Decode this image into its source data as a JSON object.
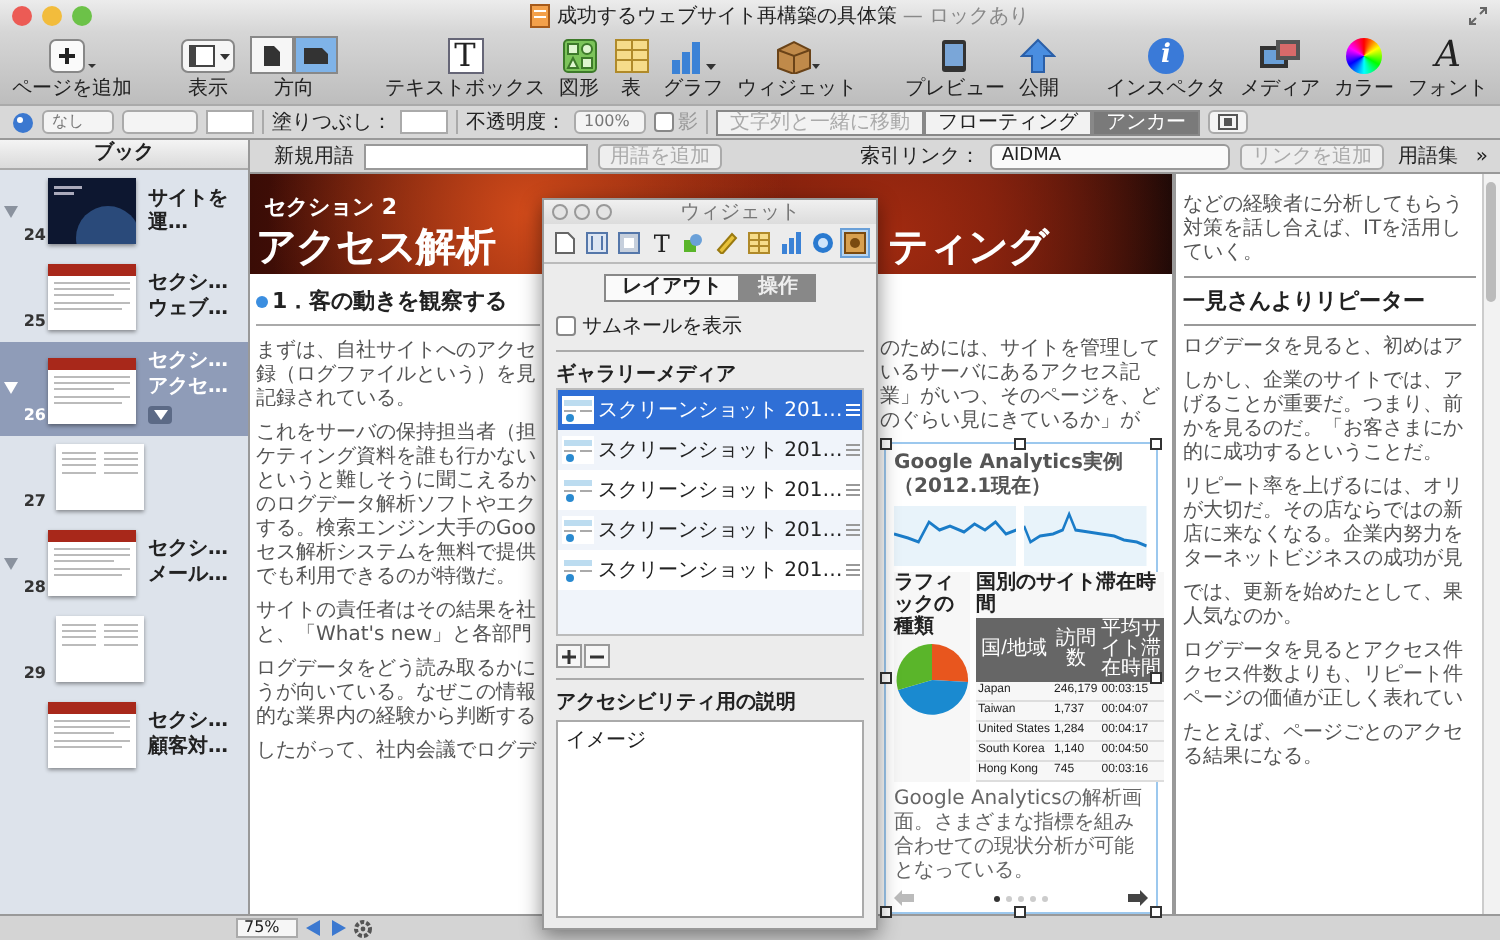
{
  "window": {
    "title": "成功するウェブサイト再構築の具体策",
    "suffix": "— ロックあり"
  },
  "toolbar": [
    {
      "kind": "add",
      "label": "ページを追加"
    },
    {
      "kind": "view",
      "label": "表示"
    },
    {
      "kind": "orientation",
      "label": "方向",
      "segments": [
        {
          "selected": false
        },
        {
          "selected": true
        }
      ]
    },
    {
      "kind": "textbox",
      "label": "テキストボックス",
      "glyph": "T"
    },
    {
      "kind": "shapes",
      "label": "図形"
    },
    {
      "kind": "table",
      "label": "表"
    },
    {
      "kind": "chart",
      "label": "グラフ"
    },
    {
      "kind": "widget",
      "label": "ウィジェット"
    },
    {
      "kind": "preview",
      "label": "プレビュー"
    },
    {
      "kind": "publish",
      "label": "公開"
    },
    {
      "kind": "inspector",
      "label": "インスペクタ",
      "glyph": "i"
    },
    {
      "kind": "media",
      "label": "メディア"
    },
    {
      "kind": "colors",
      "label": "カラー"
    },
    {
      "kind": "fonts",
      "label": "フォント",
      "glyph": "A"
    }
  ],
  "format_bar": {
    "line_style": "なし",
    "fill_label": "塗りつぶし：",
    "opacity_label": "不透明度：",
    "opacity": "100%",
    "shadow": {
      "label": "影",
      "checked": false
    },
    "wrap_modes": [
      {
        "label": "文字列と一緒に移動",
        "selected": false,
        "disabled": true
      },
      {
        "label": "フローティング",
        "selected": false,
        "disabled": false
      },
      {
        "label": "アンカー",
        "selected": true,
        "disabled": false
      }
    ]
  },
  "glossary_bar": {
    "new_term_label": "新規用語",
    "add_term": "用語を追加",
    "index_link_label": "索引リンク：",
    "index_link": "AIDMA",
    "add_link": "リンクを追加",
    "glossary": "用語集",
    "more": "»"
  },
  "sidebar": {
    "title": "ブック",
    "items": [
      {
        "number": "24",
        "labels": [
          "サイトを運…"
        ],
        "kind": "dark",
        "expanded": true,
        "selected": false
      },
      {
        "number": "25",
        "labels": [
          "セクシ…",
          "ウェブ…"
        ],
        "kind": "section",
        "expanded": false,
        "selected": false
      },
      {
        "number": "26",
        "labels": [
          "セクシ…",
          "アクセ…"
        ],
        "kind": "section",
        "expanded": true,
        "selected": true,
        "children": [
          {
            "number": "27",
            "kind": "plain",
            "expanded": false,
            "selected": false
          }
        ]
      },
      {
        "number": "28",
        "labels": [
          "セクシ…",
          "メール…"
        ],
        "kind": "section",
        "expanded": true,
        "selected": false,
        "children": [
          {
            "number": "29",
            "kind": "plain",
            "expanded": false,
            "selected": false
          }
        ]
      },
      {
        "labels": [
          "セクシ…",
          "顧客対…"
        ],
        "kind": "section",
        "expanded": false,
        "selected": false
      }
    ]
  },
  "page": {
    "banner": {
      "section": "セクション 2",
      "title_left": "アクセス解析",
      "title_right": "ティング"
    },
    "heading": "1．客の動きを観察する",
    "paragraphs": [
      [
        "まずは、自社サイトへのアクセ",
        "録（ログファイルという）を見",
        "記録されている。"
      ],
      [
        "これをサーバの保持担当者（担",
        "ケティング資料を誰も行かない",
        "というと難しそうに聞こえるか",
        "のログデータ解析ソフトやエク",
        "する。検索エンジン大手のGoo",
        "セス解析システムを無料で提供",
        "でも利用できるのが特徴だ。"
      ],
      [
        "サイトの責任者はその結果を社",
        "と、「What's new」と各部門"
      ],
      [
        "ログデータをどう読み取るかに",
        "うが向いている。なぜこの情報",
        "的な業界内の経験から判断する"
      ],
      [
        "したがって、社内会議でログデ"
      ]
    ],
    "right_fragments": [
      "のためには、サイトを管理しているサーバにあるアクセス記",
      "業」がいつ、そのページを、どのぐらい見にきているか」が"
    ]
  },
  "gallery": {
    "title": "Google Analytics実例（2012.1現在）",
    "pie_title": "ラフィックの種類",
    "table_title": "国別のサイト滞在時間",
    "columns": [
      "国/地域",
      "訪問数",
      "平均サイト滞在時間"
    ],
    "rows": [
      [
        "Japan",
        "246,179",
        "00:03:15"
      ],
      [
        "Taiwan",
        "1,737",
        "00:04:07"
      ],
      [
        "United States",
        "1,284",
        "00:04:17"
      ],
      [
        "South Korea",
        "1,140",
        "00:04:50"
      ],
      [
        "Hong Kong",
        "745",
        "00:03:16"
      ]
    ],
    "caption": "Google Analyticsの解析画面。さまざまな指標を組み合わせての現状分析が可能となっている。",
    "dots": [
      {
        "selected": true
      },
      {
        "selected": false
      },
      {
        "selected": false
      },
      {
        "selected": false
      },
      {
        "selected": false
      }
    ]
  },
  "widget_panel": {
    "title": "ウィジェット",
    "tools": [
      {
        "kind": "page",
        "selected": false
      },
      {
        "kind": "columns",
        "selected": false
      },
      {
        "kind": "frame",
        "selected": false
      },
      {
        "kind": "text",
        "glyph": "T",
        "selected": false
      },
      {
        "kind": "shapes",
        "selected": false
      },
      {
        "kind": "ruler",
        "selected": false
      },
      {
        "kind": "table",
        "selected": false
      },
      {
        "kind": "chart",
        "selected": false
      },
      {
        "kind": "globe",
        "selected": false
      },
      {
        "kind": "widget",
        "selected": true
      }
    ],
    "tabs": [
      {
        "label": "レイアウト",
        "selected": false
      },
      {
        "label": "操作",
        "selected": true
      }
    ],
    "show_thumbnails": {
      "label": "サムネールを表示",
      "checked": false
    },
    "media_heading": "ギャラリーメディア",
    "media": [
      {
        "name": "スクリーンショット 201…",
        "selected": true
      },
      {
        "name": "スクリーンショット 201…",
        "selected": false
      },
      {
        "name": "スクリーンショット 201…",
        "selected": false
      },
      {
        "name": "スクリーンショット 201…",
        "selected": false
      },
      {
        "name": "スクリーンショット 201…",
        "selected": false
      }
    ],
    "accessibility_heading": "アクセシビリティ用の説明",
    "accessibility_text": "イメージ"
  },
  "right_page": {
    "top_lines": [
      "などの経験者に分析してもらう",
      "対策を話し合えば、ITを活用し",
      "ていく。"
    ],
    "heading": "一見さんよりリピーター",
    "paragraphs": [
      [
        "ログデータを見ると、初めはア"
      ],
      [
        "しかし、企業のサイトでは、ア",
        "げることが重要だ。つまり、前",
        "かを見るのだ。「お客さまにか",
        "的に成功するということだ。"
      ],
      [
        "リピート率を上げるには、オリ",
        "が大切だ。その店ならではの新",
        "店に来なくなる。企業内努力を",
        "ターネットビジネスの成功が見"
      ],
      [
        "では、更新を始めたとして、果",
        "人気なのか。"
      ],
      [
        "ログデータを見るとアクセス件",
        "クセス件数よりも、リピート件",
        "ページの価値が正しく表れてい"
      ],
      [
        "たとえば、ページごとのアクセ",
        "る結果になる。"
      ]
    ]
  },
  "status_bar": {
    "zoom": "75%"
  }
}
